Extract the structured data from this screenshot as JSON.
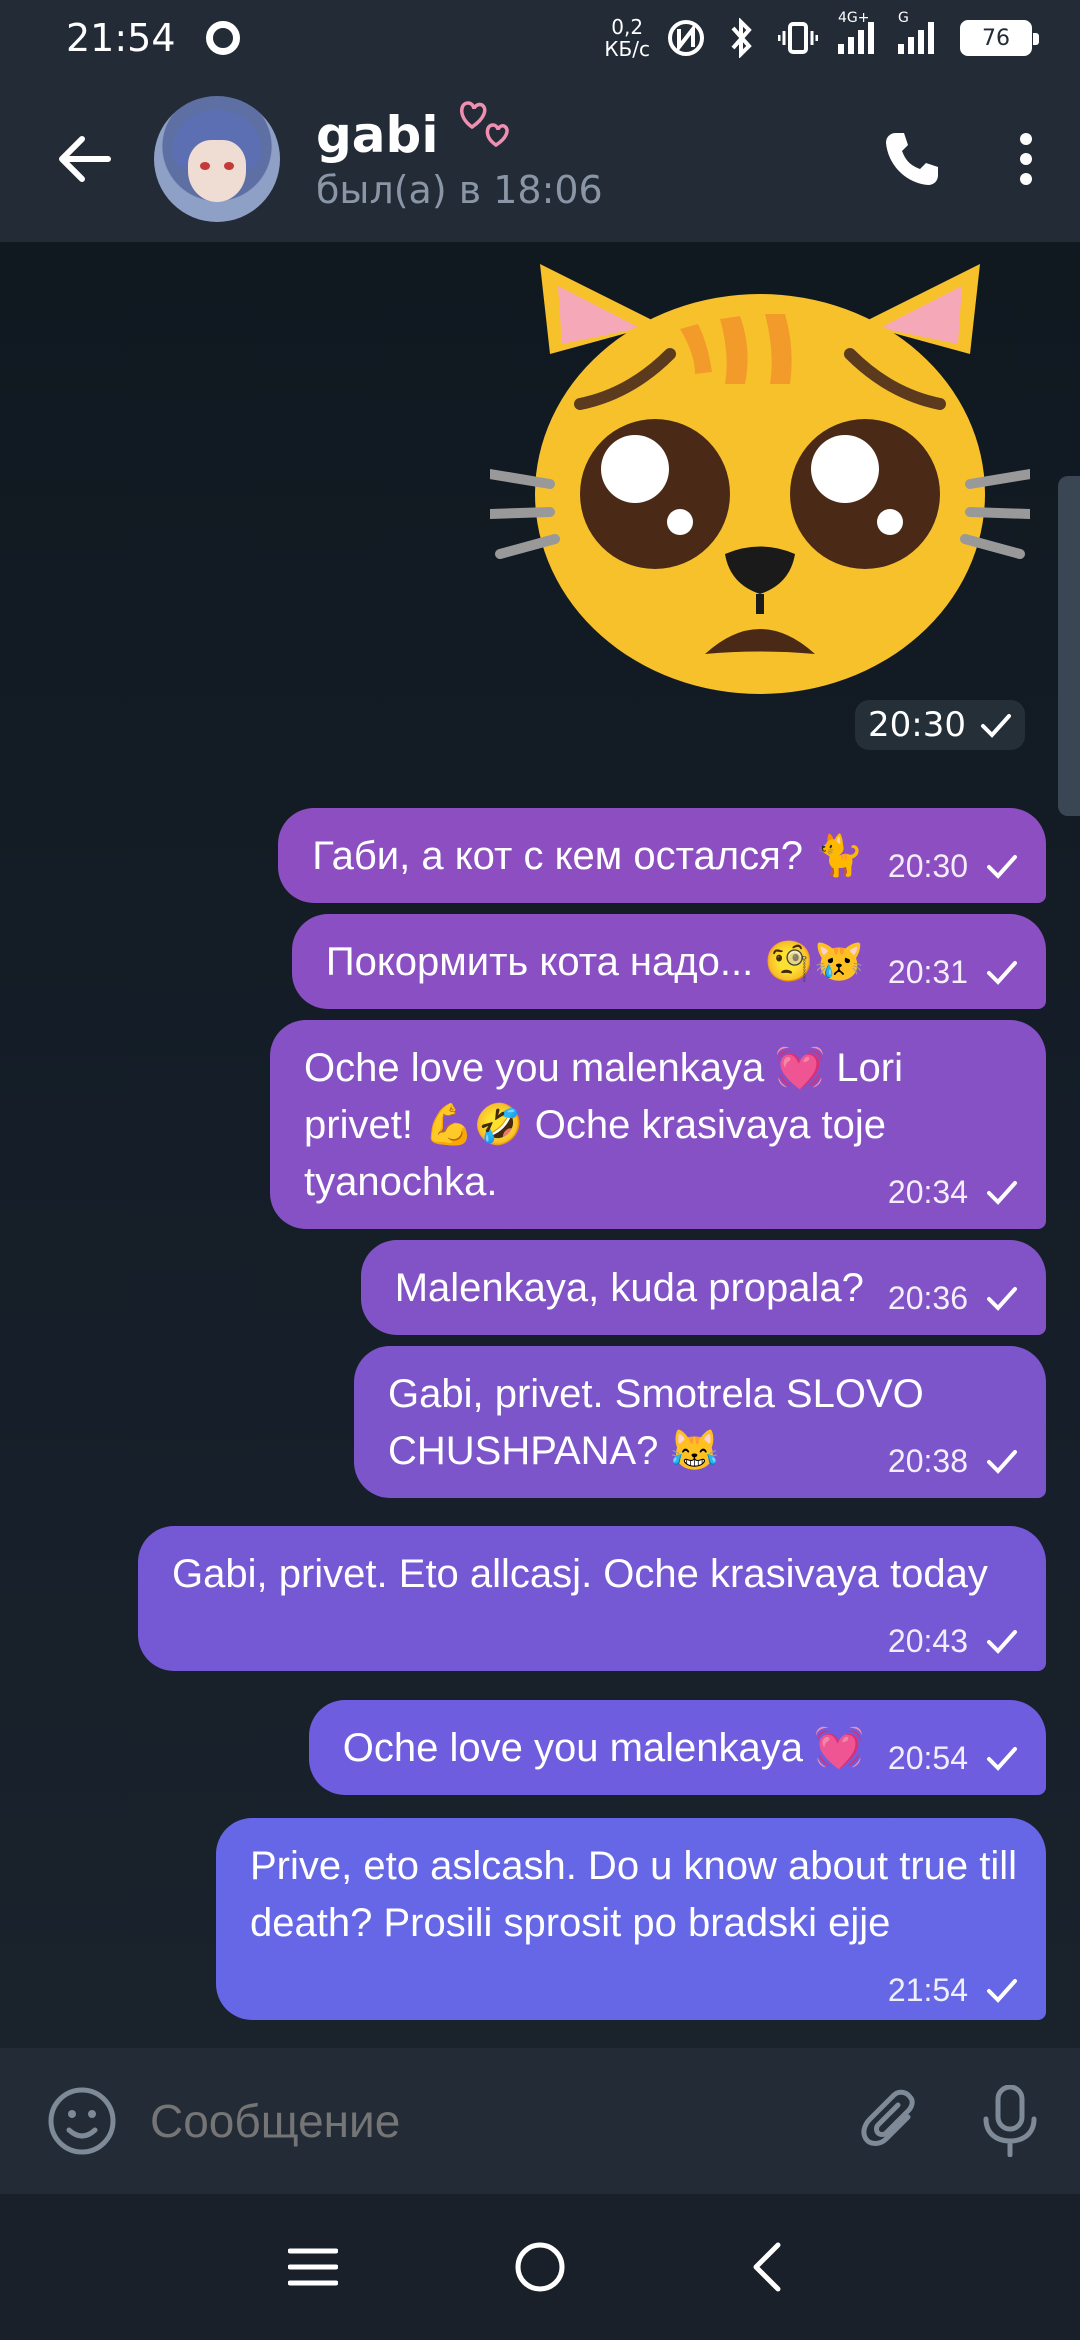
{
  "status_bar": {
    "time": "21:54",
    "net_speed_value": "0,2",
    "net_speed_unit": "КБ/с",
    "network_1": "4G+",
    "network_2": "G",
    "battery": "76"
  },
  "header": {
    "name": "gabi",
    "last_seen": "был(а) в 18:06"
  },
  "sticker": {
    "emoji": "pleading-cat",
    "time": "20:30"
  },
  "messages": [
    {
      "text": "Габи, а кот с кем остался? 🐈",
      "time": "20:30"
    },
    {
      "text": "Покормить кота надо... 🧐😿",
      "time": "20:31"
    },
    {
      "text": "Oche love you malenkaya 💓 Lori privet! 💪🤣 Oche krasivaya toje tyanochka.",
      "time": "20:34"
    },
    {
      "text": "Malenkaya, kuda propala?",
      "time": "20:36"
    },
    {
      "text": "Gabi, privet. Smotrela SLOVO CHUSHPANA? 😹",
      "time": "20:38"
    },
    {
      "text": "Gabi, privet. Eto allcasj. Oche krasivaya today",
      "time": "20:43"
    },
    {
      "text": "Oche love you malenkaya 💓",
      "time": "20:54"
    },
    {
      "text": "Prive, eto aslcash. Do u know about true till death? Prosili sprosit po bradski ejje",
      "time": "21:54"
    }
  ],
  "composer": {
    "placeholder": "Сообщение"
  },
  "colors": {
    "bubble_top": "#8c4ec0",
    "bubble_bottom": "#6368e8",
    "background": "#1c242f",
    "header": "#222b36"
  },
  "icons": [
    "back-arrow-icon",
    "phone-icon",
    "more-vert-icon",
    "emoji-icon",
    "attach-icon",
    "mic-icon",
    "menu-icon",
    "home-icon",
    "back-nav-icon"
  ]
}
